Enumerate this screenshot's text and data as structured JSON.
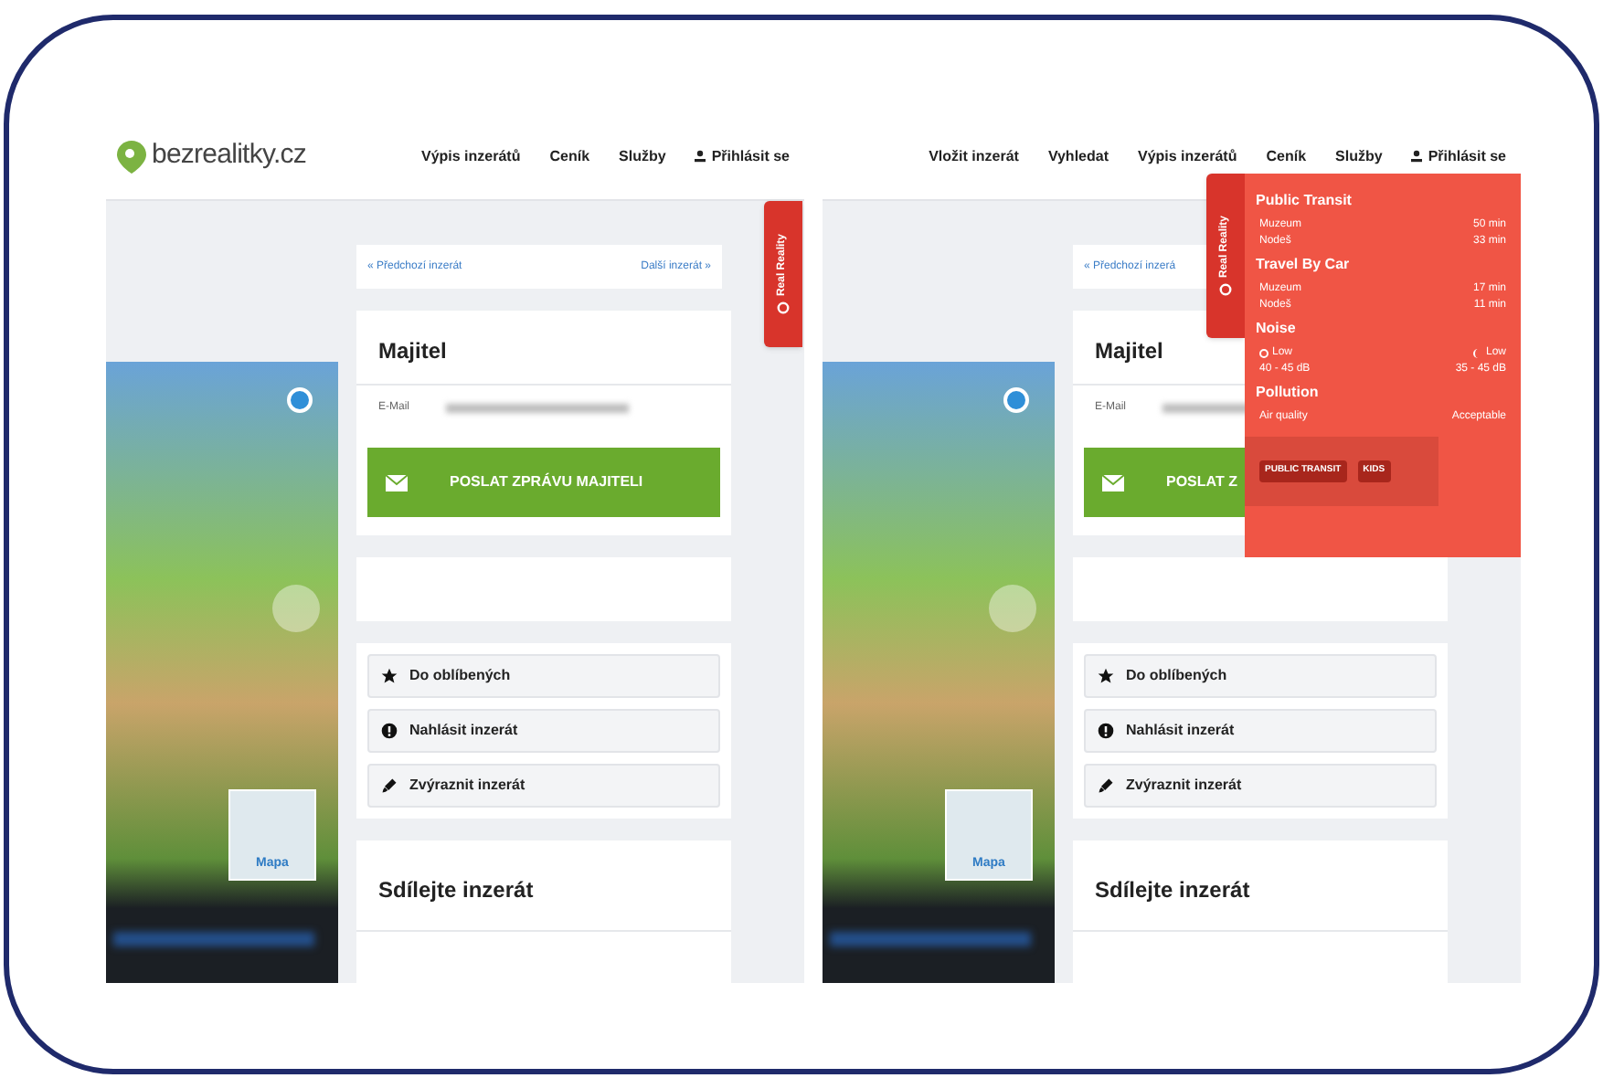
{
  "screenshots": [
    {
      "logo": "bezrealitky.cz",
      "nav": [
        "Výpis inzerátů",
        "Ceník",
        "Služby"
      ],
      "login": "Přihlásit se",
      "side_tab": "Real Reality",
      "prev_link": "« Předchozí inzerát",
      "next_link": "Další inzerát »",
      "owner": {
        "title": "Majitel",
        "email_label": "E-Mail",
        "button": "POSLAT ZPRÁVU MAJITELI"
      },
      "actions": [
        {
          "kind": "star",
          "label": "Do oblíbených"
        },
        {
          "kind": "alert",
          "label": "Nahlásit inzerát"
        },
        {
          "kind": "marker",
          "label": "Zvýraznit inzerát"
        }
      ],
      "share_title": "Sdílejte inzerát",
      "map_label": "Mapa"
    },
    {
      "nav": [
        "Vložit inzerát",
        "Vyhledat",
        "Výpis inzerátů",
        "Ceník",
        "Služby"
      ],
      "login": "Přihlásit se",
      "side_tab": "Real Reality",
      "prev_link": "« Předchozí inzerá",
      "owner": {
        "title": "Majitel",
        "email_label": "E-Mail",
        "button": "POSLAT Z"
      },
      "actions": [
        {
          "kind": "star",
          "label": "Do oblíbených"
        },
        {
          "kind": "alert",
          "label": "Nahlásit inzerát"
        },
        {
          "kind": "marker",
          "label": "Zvýraznit inzerát"
        }
      ],
      "share_title": "Sdílejte inzerát",
      "map_label": "Mapa",
      "popup": {
        "sections": [
          {
            "title": "Public Transit",
            "rows": [
              {
                "kind": "plain",
                "left": "Muzeum",
                "right": "50 min"
              },
              {
                "kind": "plain",
                "left": "Nodeš",
                "right": "33 min"
              }
            ]
          },
          {
            "title": "Travel By Car",
            "rows": [
              {
                "kind": "plain",
                "left": "Muzeum",
                "right": "17 min"
              },
              {
                "kind": "plain",
                "left": "Nodeš",
                "right": "11 min"
              }
            ]
          },
          {
            "title": "Noise",
            "rows": [
              {
                "kind": "noise",
                "left": "Low",
                "right": "Low"
              },
              {
                "kind": "plain",
                "left": "40 - 45 dB",
                "right": "35 - 45 dB"
              }
            ]
          },
          {
            "title": "Pollution",
            "rows": [
              {
                "kind": "plain",
                "left": "Air quality",
                "right": "Acceptable"
              }
            ]
          }
        ],
        "tags": [
          "PUBLIC TRANSIT",
          "KIDS"
        ]
      }
    }
  ]
}
